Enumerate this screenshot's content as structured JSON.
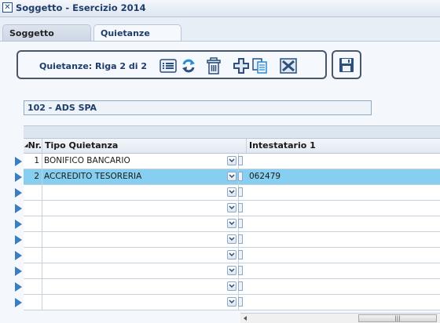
{
  "window": {
    "title": "Soggetto - Esercizio 2014"
  },
  "tabs": [
    {
      "label": "Soggetto"
    },
    {
      "label": "Quietanze"
    }
  ],
  "toolbar": {
    "label": "Quietanze:  Riga 2 di 2",
    "buttons": [
      "list-icon",
      "refresh-icon",
      "trash-icon",
      "add-icon",
      "copy-icon",
      "excel-icon"
    ],
    "save_icon": "save-icon"
  },
  "subject": {
    "value": "102 - ADS SPA"
  },
  "grid": {
    "columns": {
      "nr": "Nr.",
      "tipo": "Tipo Quietanza",
      "intestatario": "Intestatario 1"
    },
    "rows": [
      {
        "nr": "1",
        "tipo": "BONIFICO BANCARIO",
        "intestatario": ""
      },
      {
        "nr": "2",
        "tipo": "ACCREDITO TESORERIA",
        "intestatario": "062479"
      },
      {
        "nr": "",
        "tipo": "",
        "intestatario": ""
      },
      {
        "nr": "",
        "tipo": "",
        "intestatario": ""
      },
      {
        "nr": "",
        "tipo": "",
        "intestatario": ""
      },
      {
        "nr": "",
        "tipo": "",
        "intestatario": ""
      },
      {
        "nr": "",
        "tipo": "",
        "intestatario": ""
      },
      {
        "nr": "",
        "tipo": "",
        "intestatario": ""
      },
      {
        "nr": "",
        "tipo": "",
        "intestatario": ""
      },
      {
        "nr": "",
        "tipo": "",
        "intestatario": ""
      }
    ],
    "selected_row": 2
  },
  "colors": {
    "accent": "#1e3d6b",
    "selection": "#87cff0",
    "row_arrow": "#3a7ec0"
  }
}
